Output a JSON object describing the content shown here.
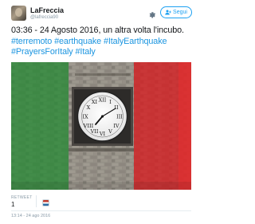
{
  "user": {
    "display_name": "LaFreccia",
    "screen_name": "@lafreccia90"
  },
  "header": {
    "settings_icon": "gear-icon",
    "follow_label": "Segui",
    "follow_icon": "add-user-icon",
    "accent_color": "#1da1f2"
  },
  "tweet": {
    "line1": "03:36 - 24 Agosto 2016, un altra volta l'incubo.",
    "hashtags_line2": [
      "#terremoto",
      "#earthquake",
      "#ItalyEarthquake"
    ],
    "hashtags_line3": [
      "#PrayersForItaly",
      "#Italy"
    ],
    "hashtag_color": "#1b95e0"
  },
  "media": {
    "description_icon": "clock-tower-image",
    "flag_colors": [
      "#2e8b3e",
      "#ffffff",
      "#d8262a"
    ]
  },
  "stats": {
    "retweets_label": "RETWEET",
    "retweets_count": "1"
  },
  "footer": {
    "timestamp": "13:14 - 24 ago 2016"
  }
}
